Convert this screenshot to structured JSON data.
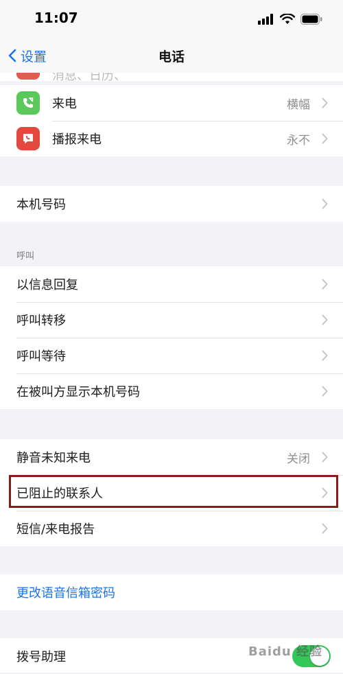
{
  "status_bar": {
    "time": "11:07",
    "icons": [
      "signal-icon",
      "wifi-icon",
      "battery-icon"
    ]
  },
  "nav": {
    "back_label": "设置",
    "title": "电话"
  },
  "group_top": {
    "partial_label": "消息、日历、",
    "rows": [
      {
        "label": "来电",
        "value": "横幅",
        "icon": "incoming-call-icon",
        "icon_color": "#5ac85a"
      },
      {
        "label": "播报来电",
        "value": "永不",
        "icon": "announce-call-icon",
        "icon_color": "#e4493f"
      }
    ]
  },
  "group_number": {
    "rows": [
      {
        "label": "本机号码"
      }
    ]
  },
  "section_calls": {
    "header": "呼叫",
    "rows": [
      {
        "label": "以信息回复"
      },
      {
        "label": "呼叫转移"
      },
      {
        "label": "呼叫等待"
      },
      {
        "label": "在被叫方显示本机号码"
      }
    ]
  },
  "group_silence": {
    "rows": [
      {
        "label": "静音未知来电",
        "value": "关闭"
      },
      {
        "label": "已阻止的联系人"
      },
      {
        "label": "短信/来电报告"
      }
    ]
  },
  "group_voicemail": {
    "link_label": "更改语音信箱密码"
  },
  "group_dial": {
    "label": "拨号助理",
    "toggle_on": true
  },
  "colors": {
    "accent": "#1a73e8",
    "highlight_border": "#8b1a1a",
    "toggle_on": "#34c759"
  },
  "watermark": "Baidu 经验"
}
